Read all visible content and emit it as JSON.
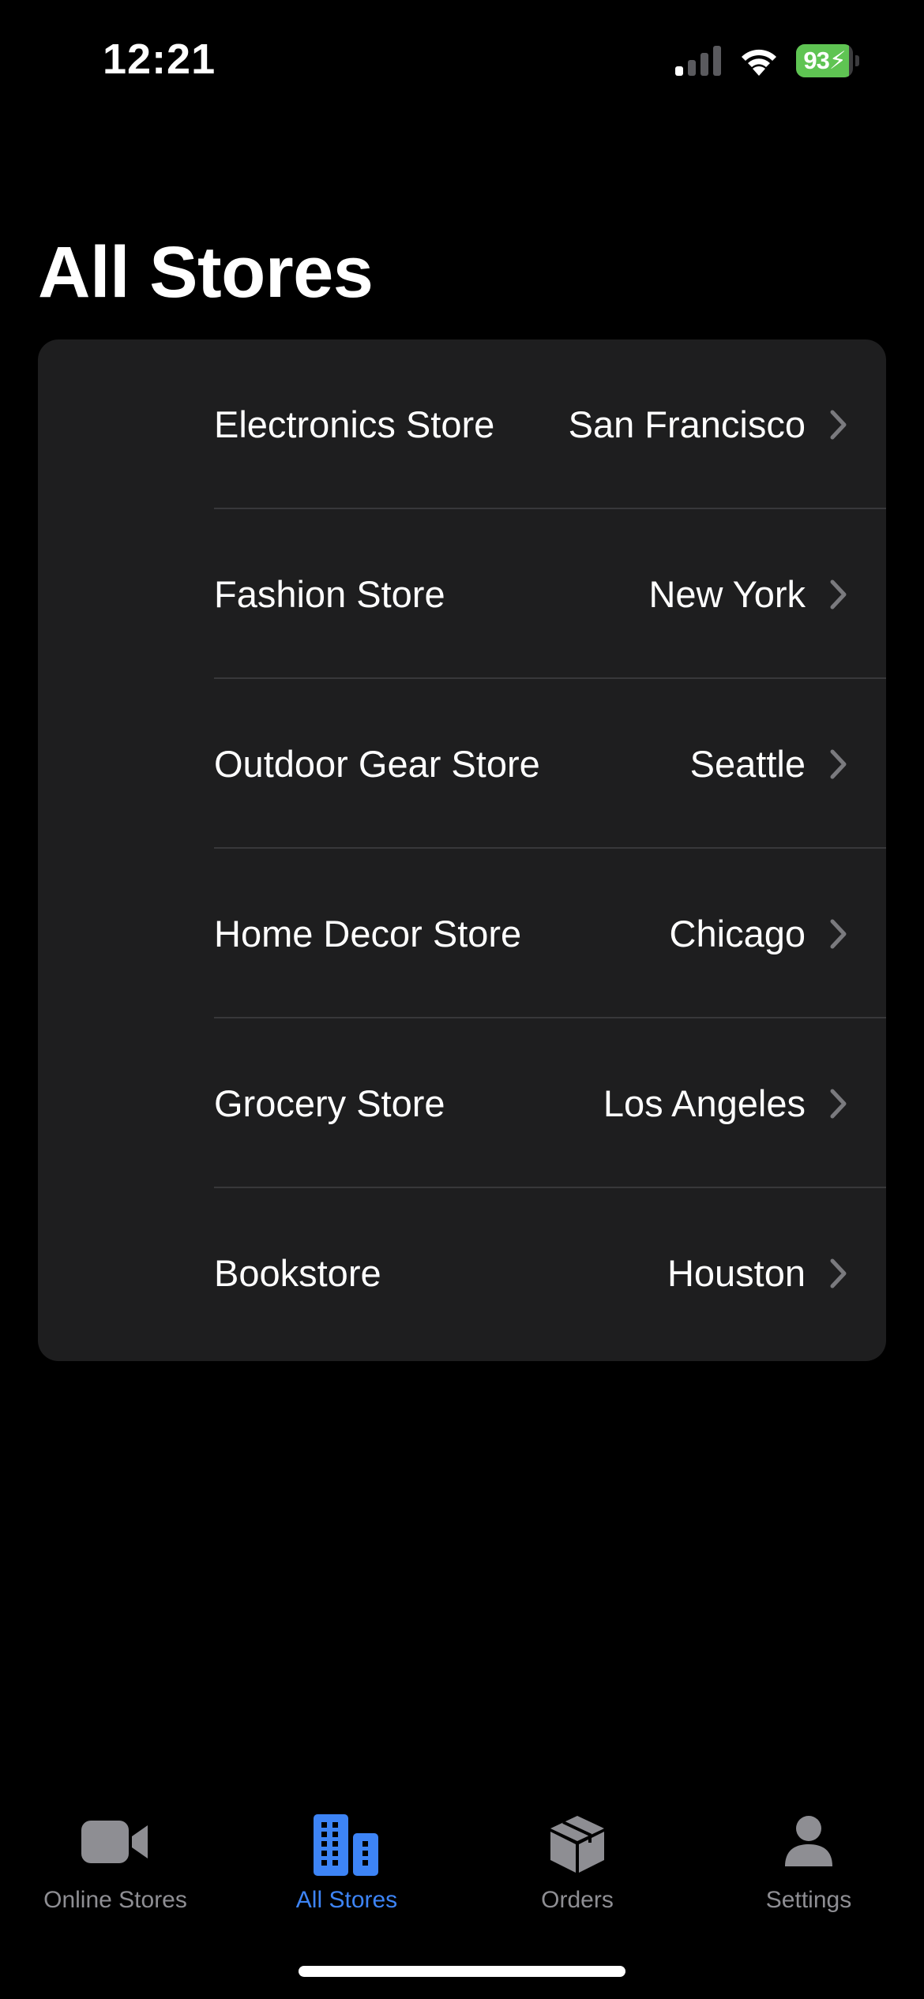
{
  "status_bar": {
    "time": "12:21",
    "battery_text": "93",
    "battery_level": 0.93,
    "signal_bars_active": 1,
    "signal_bars_total": 4,
    "battery_color": "#5fc453"
  },
  "page": {
    "title": "All Stores"
  },
  "stores": [
    {
      "name": "Electronics Store",
      "city": "San Francisco",
      "icon": "chevron-right-icon"
    },
    {
      "name": "Fashion Store",
      "city": "New York",
      "icon": "chevron-right-icon"
    },
    {
      "name": "Outdoor Gear Store",
      "city": "Seattle",
      "icon": "chevron-right-icon"
    },
    {
      "name": "Home Decor Store",
      "city": "Chicago",
      "icon": "chevron-right-icon"
    },
    {
      "name": "Grocery Store",
      "city": "Los Angeles",
      "icon": "chevron-right-icon"
    },
    {
      "name": "Bookstore",
      "city": "Houston",
      "icon": "chevron-right-icon"
    }
  ],
  "tab_bar": {
    "active_index": 1,
    "active_color": "#3d84f6",
    "inactive_color": "#8e8e93",
    "tabs": [
      {
        "label": "Online Stores",
        "icon": "video-camera-icon"
      },
      {
        "label": "All Stores",
        "icon": "buildings-icon"
      },
      {
        "label": "Orders",
        "icon": "shipping-box-icon"
      },
      {
        "label": "Settings",
        "icon": "person-icon"
      }
    ]
  },
  "colors": {
    "background": "#000000",
    "card": "#1e1e1f",
    "divider": "#38383a",
    "text_primary": "#ffffff",
    "chevron": "#7a7a7e"
  }
}
